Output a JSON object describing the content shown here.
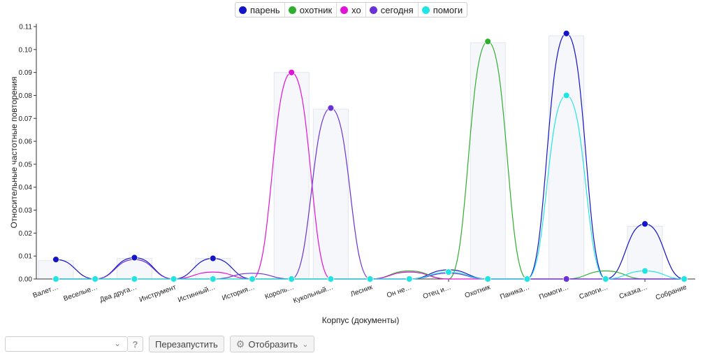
{
  "legend": [
    {
      "name": "парень",
      "color": "#1414c8"
    },
    {
      "name": "охотник",
      "color": "#2fae2f"
    },
    {
      "name": "хо",
      "color": "#e014d8"
    },
    {
      "name": "сегодня",
      "color": "#6a32d6"
    },
    {
      "name": "помоги",
      "color": "#22e4e4"
    }
  ],
  "toolbar": {
    "select_value": "",
    "help_icon": "?",
    "restart_label": "Перезапустить",
    "display_label": "Отобразить",
    "display_icon": "gear-icon"
  },
  "chart_data": {
    "type": "line",
    "title": "",
    "xlabel": "Корпус (документы)",
    "ylabel": "Относительные частотные повторения",
    "ylim": [
      0,
      0.11
    ],
    "yticks": [
      "0.00",
      "0.01",
      "0.02",
      "0.03",
      "0.04",
      "0.05",
      "0.06",
      "0.07",
      "0.08",
      "0.09",
      "0.10",
      "0.11"
    ],
    "categories": [
      "Валет…",
      "Веселые…",
      "Два друга…",
      "Инструмент",
      "Истинный…",
      "История…",
      "Король…",
      "Кукольный…",
      "Лесник",
      "Он не…",
      "Отец и…",
      "Охотник",
      "Паника…",
      "Помоги…",
      "Сапоги…",
      "Сказка…",
      "Собрание"
    ],
    "bars": [
      0.008,
      0,
      0.009,
      0,
      0.009,
      0,
      0.09,
      0.074,
      0,
      0,
      0,
      0.103,
      0,
      0.106,
      0,
      0.023,
      0
    ],
    "series": [
      {
        "name": "парень",
        "values": [
          0.0085,
          0,
          0.0093,
          0,
          0.009,
          0,
          0,
          0,
          0,
          0,
          0.004,
          0,
          0,
          0.107,
          0,
          0.024,
          0
        ],
        "markers": [
          0,
          2,
          4,
          13,
          15
        ]
      },
      {
        "name": "охотник",
        "values": [
          0,
          0,
          0,
          0,
          0,
          0,
          0,
          0,
          0,
          0.0035,
          0,
          0.1035,
          0,
          0,
          0.0035,
          0,
          0
        ],
        "markers": [
          11
        ]
      },
      {
        "name": "хо",
        "values": [
          0,
          0,
          0,
          0,
          0.003,
          0,
          0.09,
          0,
          0,
          0.003,
          0,
          0,
          0,
          0,
          0,
          0,
          0
        ],
        "markers": [
          6
        ]
      },
      {
        "name": "сегодня",
        "values": [
          0,
          0,
          0.0085,
          0,
          0,
          0.0025,
          0,
          0.0745,
          0,
          0,
          0.0025,
          0,
          0,
          0,
          0,
          0,
          0
        ],
        "markers": [
          7,
          13
        ]
      },
      {
        "name": "помоги",
        "values": [
          0,
          0,
          0,
          0,
          0,
          0,
          0,
          0,
          0,
          0,
          0.003,
          0,
          0,
          0.08,
          0,
          0.0035,
          0
        ],
        "markers": [
          0,
          1,
          2,
          3,
          4,
          5,
          6,
          7,
          8,
          9,
          10,
          11,
          12,
          13,
          14,
          15,
          16
        ]
      }
    ]
  }
}
